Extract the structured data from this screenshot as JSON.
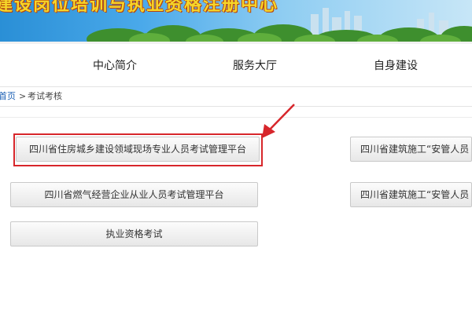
{
  "banner": {
    "title": "建设岗位培训与执业资格注册中心"
  },
  "nav": {
    "items": [
      {
        "label": "中心简介"
      },
      {
        "label": "服务大厅"
      },
      {
        "label": "自身建设"
      }
    ]
  },
  "breadcrumb": {
    "home": "首页",
    "separator": ">",
    "current": "考试考核"
  },
  "platforms": {
    "left": [
      {
        "label": "四川省住房城乡建设领域现场专业人员考试管理平台",
        "highlighted": true
      },
      {
        "label": "四川省燃气经营企业从业人员考试管理平台",
        "highlighted": false
      },
      {
        "label": "执业资格考试",
        "highlighted": false
      }
    ],
    "right": [
      {
        "label": "四川省建筑施工“安管人员"
      },
      {
        "label": "四川省建筑施工“安管人员"
      }
    ]
  },
  "colors": {
    "annotation_red": "#d7262b",
    "link_blue": "#1a5fb4",
    "banner_title": "#f5d62a"
  }
}
